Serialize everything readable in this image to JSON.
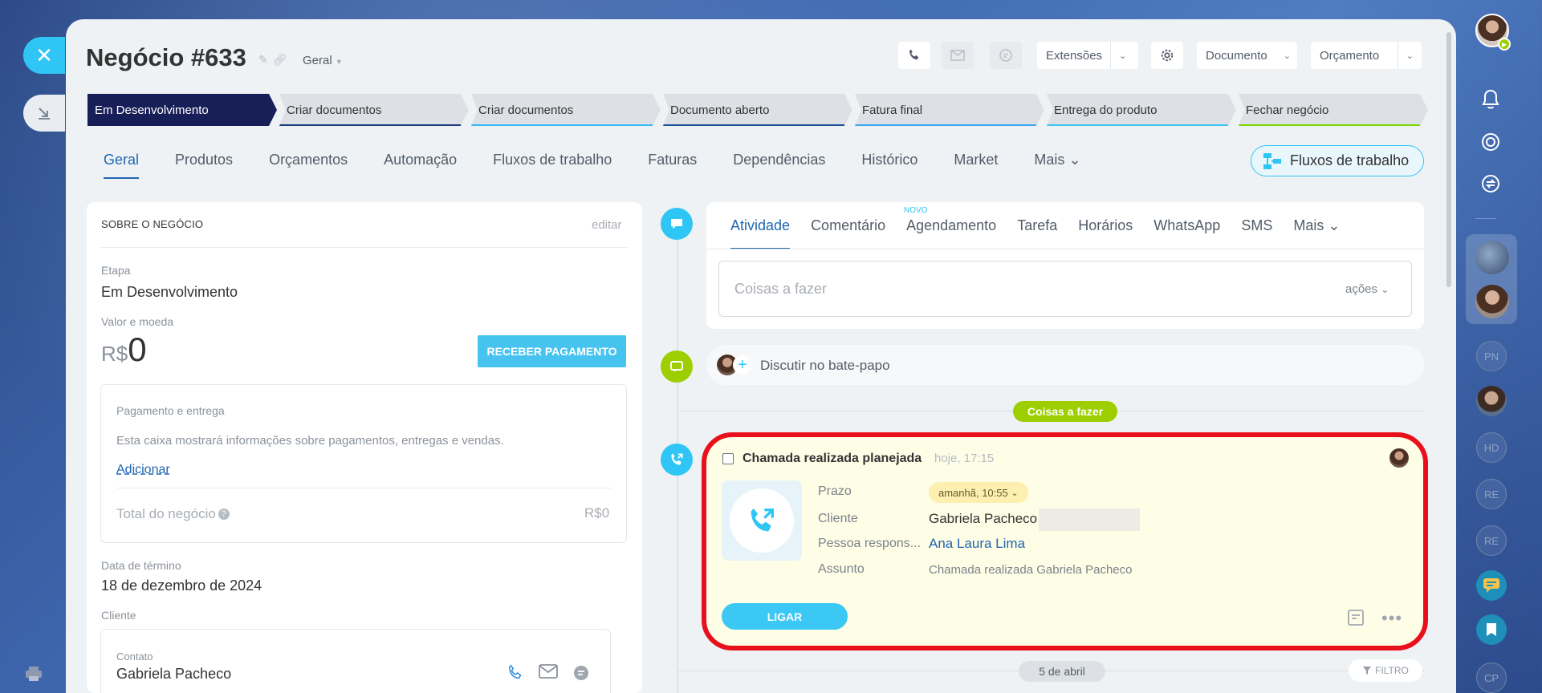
{
  "deal": {
    "title": "Negócio #633",
    "category": "Geral"
  },
  "toolbar": {
    "extensions": "Extensões",
    "document": "Documento",
    "budget": "Orçamento"
  },
  "pipeline": [
    {
      "label": "Em Desenvolvimento",
      "color": "#181e58"
    },
    {
      "label": "Criar documentos",
      "color": "#1b3a7a"
    },
    {
      "label": "Criar documentos",
      "color": "#39b7f3"
    },
    {
      "label": "Documento aberto",
      "color": "#1e4f9c"
    },
    {
      "label": "Fatura final",
      "color": "#39a8f0"
    },
    {
      "label": "Entrega do produto",
      "color": "#3ec4f2"
    },
    {
      "label": "Fechar negócio",
      "color": "#7bd500"
    }
  ],
  "tabs": [
    "Geral",
    "Produtos",
    "Orçamentos",
    "Automação",
    "Fluxos de trabalho",
    "Faturas",
    "Dependências",
    "Histórico",
    "Market",
    "Mais"
  ],
  "flows_button": "Fluxos de trabalho",
  "about": {
    "section_title": "SOBRE O NEGÓCIO",
    "edit": "editar",
    "stage_label": "Etapa",
    "stage_value": "Em Desenvolvimento",
    "amount_label": "Valor e moeda",
    "currency": "R$",
    "amount": "0",
    "receive_button": "RECEBER PAGAMENTO",
    "payment": {
      "title": "Pagamento e entrega",
      "description": "Esta caixa mostrará informações sobre pagamentos, entregas e vendas.",
      "add_link": "Adicionar",
      "total_label": "Total do negócio",
      "total_value": "R$0"
    },
    "end_date_label": "Data de término",
    "end_date_value": "18 de dezembro de 2024",
    "client_label": "Cliente",
    "contact_label": "Contato",
    "contact_name": "Gabriela Pacheco"
  },
  "activity": {
    "tabs": [
      "Atividade",
      "Comentário",
      "Agendamento",
      "Tarefa",
      "Horários",
      "WhatsApp",
      "SMS",
      "Mais"
    ],
    "new_badge": "NOVO",
    "todo_placeholder": "Coisas a fazer",
    "actions": "ações"
  },
  "chat": {
    "label": "Discutir no bate-papo"
  },
  "timeline": {
    "todo_pill": "Coisas a fazer",
    "date_pill": "5 de abril",
    "filter": "FILTRO"
  },
  "call": {
    "title": "Chamada realizada planejada",
    "time": "hoje, 17:15",
    "deadline_label": "Prazo",
    "deadline_value": "amanhã, 10:55",
    "client_label": "Cliente",
    "client_value": "Gabriela Pacheco",
    "responsible_label": "Pessoa respons...",
    "responsible_value": "Ana Laura Lima",
    "subject_label": "Assunto",
    "subject_value": "Chamada realizada Gabriela Pacheco",
    "call_button": "LIGAR"
  },
  "right_sidebar": {
    "initials": [
      "PN",
      "HD",
      "RE",
      "RE",
      "CP"
    ]
  },
  "colors": {
    "accent": "#2fc6f6",
    "link": "#2066b0",
    "danger": "#e8101c",
    "green": "#9dcf00"
  }
}
